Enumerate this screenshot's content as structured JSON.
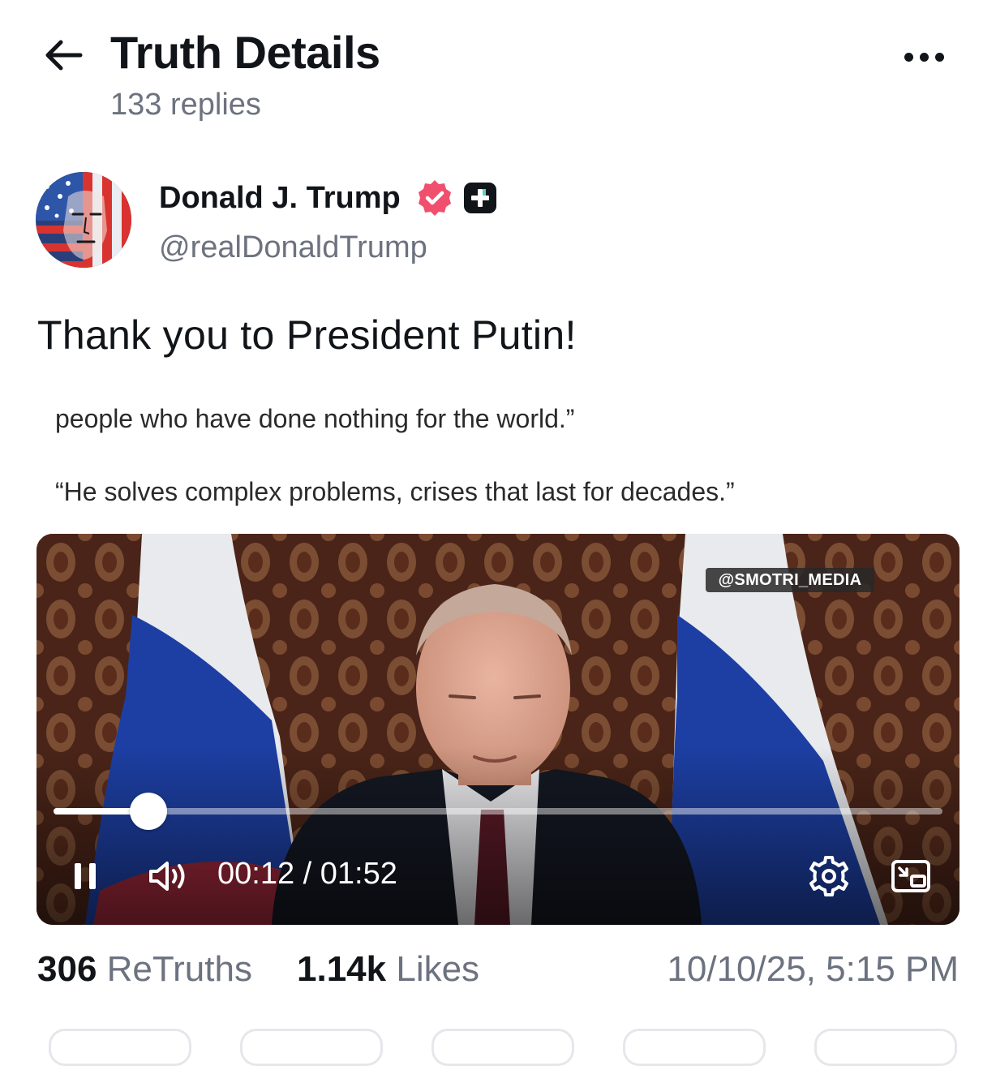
{
  "header": {
    "title": "Truth Details",
    "reply_count": "133 replies",
    "back_icon": "arrow-left-icon",
    "more_icon": "more-horizontal-icon"
  },
  "author": {
    "name": "Donald J. Trump",
    "handle": "@realDonaldTrump",
    "verified_icon": "verified-badge-icon",
    "verified_color": "#f0506e",
    "plus_icon": "truth-plus-icon"
  },
  "post": {
    "text": "Thank you to President Putin!",
    "quote_line_1": "people who have done nothing for the world.”",
    "quote_line_2": "“He solves complex problems, crises that last for decades.”"
  },
  "video": {
    "watermark": "@SMOTRI_MEDIA",
    "current_time": "00:12",
    "duration": "01:52",
    "time_display": "00:12 / 01:52",
    "progress_fraction": 0.107,
    "icons": [
      "pause-icon",
      "volume-icon",
      "settings-icon",
      "picture-in-picture-icon"
    ]
  },
  "stats": {
    "retruths_count": "306",
    "retruths_label": "ReTruths",
    "likes_count": "1.14k",
    "likes_label": "Likes",
    "timestamp": "10/10/25, 5:15 PM"
  },
  "colors": {
    "text_primary": "#111418",
    "text_secondary": "#6c727f",
    "background": "#ffffff"
  }
}
